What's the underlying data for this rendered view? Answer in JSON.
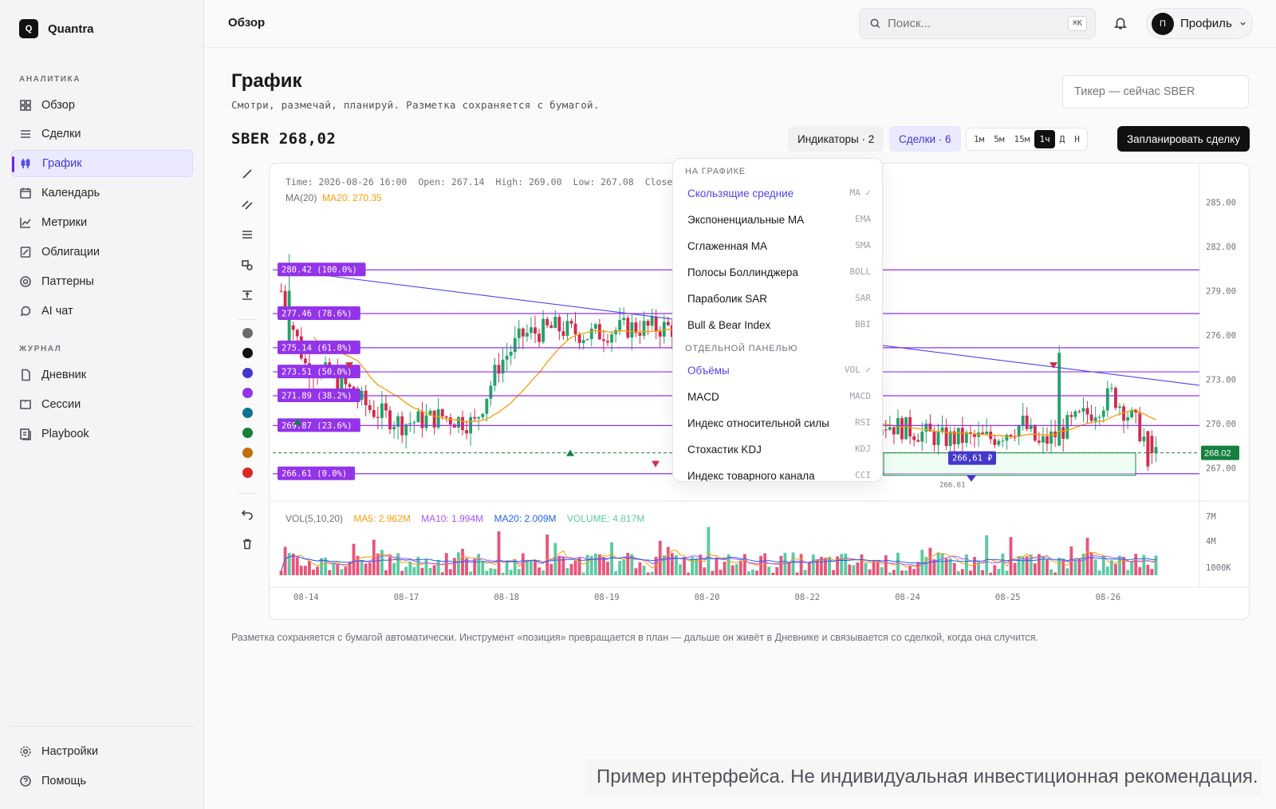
{
  "brand": {
    "logo": "Q",
    "name": "Quantra"
  },
  "sidebar": {
    "section_analytics": "АНАЛИТИКА",
    "section_journal": "ЖУРНАЛ",
    "items": [
      {
        "label": "Обзор",
        "icon": "grid-icon"
      },
      {
        "label": "Сделки",
        "icon": "list-icon"
      },
      {
        "label": "График",
        "icon": "candles-icon",
        "active": true
      },
      {
        "label": "Календарь",
        "icon": "calendar-icon"
      },
      {
        "label": "Метрики",
        "icon": "line-chart-icon"
      },
      {
        "label": "Облигации",
        "icon": "bond-icon"
      },
      {
        "label": "Паттерны",
        "icon": "target-icon"
      },
      {
        "label": "AI чат",
        "icon": "chat-icon"
      }
    ],
    "journal_items": [
      {
        "label": "Дневник",
        "icon": "file-icon"
      },
      {
        "label": "Сессии",
        "icon": "book-icon"
      },
      {
        "label": "Playbook",
        "icon": "playbook-icon"
      }
    ],
    "bottom_items": [
      {
        "label": "Настройки",
        "icon": "gear-icon"
      },
      {
        "label": "Помощь",
        "icon": "help-icon"
      }
    ]
  },
  "topbar": {
    "breadcrumb": "Обзор",
    "search_placeholder": "Поиск...",
    "shortcut": "⌘K",
    "profile_initial": "П",
    "profile_label": "Профиль"
  },
  "page": {
    "title": "График",
    "subtitle": "Смотри, размечай, планируй. Разметка сохраняется с бумагой.",
    "ticker_placeholder": "Тикер — сейчас SBER",
    "symbol": "SBER",
    "price": "268,02"
  },
  "toolbar": {
    "indicators": "Индикаторы · 2",
    "trades": "Сделки · 6",
    "timeframes": [
      "1м",
      "5м",
      "15м",
      "1ч",
      "Д",
      "Н"
    ],
    "active_timeframe": "1ч",
    "plan_button": "Запланировать сделку"
  },
  "palette": [
    "#6b6b6b",
    "#111111",
    "#4338ca",
    "#9333ea",
    "#0e7490",
    "#15803d",
    "#c2700a",
    "#dc2626"
  ],
  "chart_info": {
    "time": "Time: 2026-08-26 16:00",
    "open": "Open: 267.14",
    "high": "High: 269.00",
    "low": "Low: 267.08",
    "close": "Close",
    "ma_label": "MA(20)",
    "ma_value": "MA20: 270.35"
  },
  "vol_info": {
    "label": "VOL(5,10,20)",
    "ma5": "MA5: 2.962M",
    "ma10": "MA10: 1.994M",
    "ma20": "MA20: 2.009M",
    "volume": "VOLUME: 4.817M"
  },
  "dropdown": {
    "section_on_chart": "НА ГРАФИКЕ",
    "on_chart": [
      {
        "label": "Скользящие средние",
        "code": "MA",
        "checked": true
      },
      {
        "label": "Экспоненциальные MA",
        "code": "EMA"
      },
      {
        "label": "Сглаженная MA",
        "code": "SMA"
      },
      {
        "label": "Полосы Боллинджера",
        "code": "BOLL"
      },
      {
        "label": "Параболик SAR",
        "code": "SAR"
      },
      {
        "label": "Bull & Bear Index",
        "code": "BBI"
      }
    ],
    "section_panel": "ОТДЕЛЬНОЙ ПАНЕЛЬЮ",
    "panel": [
      {
        "label": "Объёмы",
        "code": "VOL",
        "checked": true
      },
      {
        "label": "MACD",
        "code": "MACD"
      },
      {
        "label": "Индекс относительной силы",
        "code": "RSI"
      },
      {
        "label": "Стохастик KDJ",
        "code": "KDJ"
      },
      {
        "label": "Индекс товарного канала",
        "code": "CCI"
      }
    ]
  },
  "chart_data": {
    "type": "candlestick",
    "price_axis": [
      "285.00",
      "282.00",
      "279.00",
      "276.00",
      "273.00",
      "270.00",
      "267.00"
    ],
    "ylim": [
      266,
      286
    ],
    "volume_axis": [
      "7M",
      "4M",
      "1000K"
    ],
    "x_ticks": [
      "08-14",
      "08-17",
      "08-18",
      "08-19",
      "08-20",
      "08-22",
      "08-24",
      "08-25",
      "08-26"
    ],
    "last_price": "268.02",
    "fib_levels": [
      {
        "label": "280.42 (100.0%)",
        "price": 280.42
      },
      {
        "label": "277.46 (78.6%)",
        "price": 277.46
      },
      {
        "label": "275.14 (61.8%)",
        "price": 275.14
      },
      {
        "label": "273.51 (50.0%)",
        "price": 273.51
      },
      {
        "label": "271.89 (38.2%)",
        "price": 271.89
      },
      {
        "label": "269.87 (23.6%)",
        "price": 269.87
      },
      {
        "label": "266.61 (0.0%)",
        "price": 266.61
      }
    ],
    "position_label": "266,61 ₽",
    "position_sub": "266.61",
    "ma_color": "#f59e0b",
    "up_color": "#22a36a",
    "down_color": "#d42a4a",
    "fib_color": "#9333ea"
  },
  "footnote": "Разметка сохраняется с бумагой автоматически. Инструмент «позиция» превращается в план — дальше он живёт в Дневнике и связывается со сделкой, когда она случится.",
  "disclaimer": "Пример интерфейса. Не индивидуальная инвестиционная рекомендация."
}
